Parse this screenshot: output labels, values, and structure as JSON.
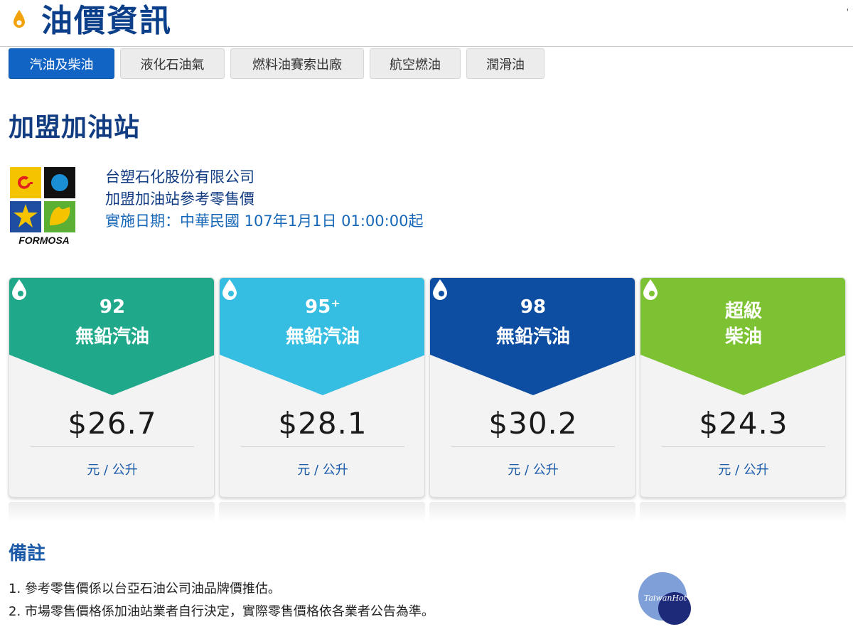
{
  "header": {
    "title": "油價資訊",
    "corner_mark": "'"
  },
  "tabs": [
    {
      "label": "汽油及柴油",
      "active": true
    },
    {
      "label": "液化石油氣",
      "active": false
    },
    {
      "label": "燃料油賽索出廠",
      "active": false
    },
    {
      "label": "航空燃油",
      "active": false
    },
    {
      "label": "潤滑油",
      "active": false
    }
  ],
  "section_title": "加盟加油站",
  "company": {
    "logo_text": "FORMOSA",
    "name": "台塑石化股份有限公司",
    "subtitle": "加盟加油站參考零售價",
    "effective_date": "實施日期：中華民國 107年1月1日 01:00:00起"
  },
  "cards": [
    {
      "line1": "92",
      "line2": "無鉛汽油",
      "price": "$26.7",
      "unit": "元 / 公升",
      "color": "#1fa88a"
    },
    {
      "line1": "95⁺",
      "line2": "無鉛汽油",
      "price": "$28.1",
      "unit": "元 / 公升",
      "color": "#36bde2"
    },
    {
      "line1": "98",
      "line2": "無鉛汽油",
      "price": "$30.2",
      "unit": "元 / 公升",
      "color": "#0e4ea2"
    },
    {
      "line1": "超級",
      "line2": "柴油",
      "price": "$24.3",
      "unit": "元 / 公升",
      "color": "#7cc232"
    }
  ],
  "notes": {
    "title": "備註",
    "items": [
      "1. 參考零售價係以台亞石油公司油品牌價推估。",
      "2. 市場零售價格係加油站業者自行決定，實際零售價格依各業者公告為準。"
    ]
  },
  "watermark": "TaiwanHot"
}
